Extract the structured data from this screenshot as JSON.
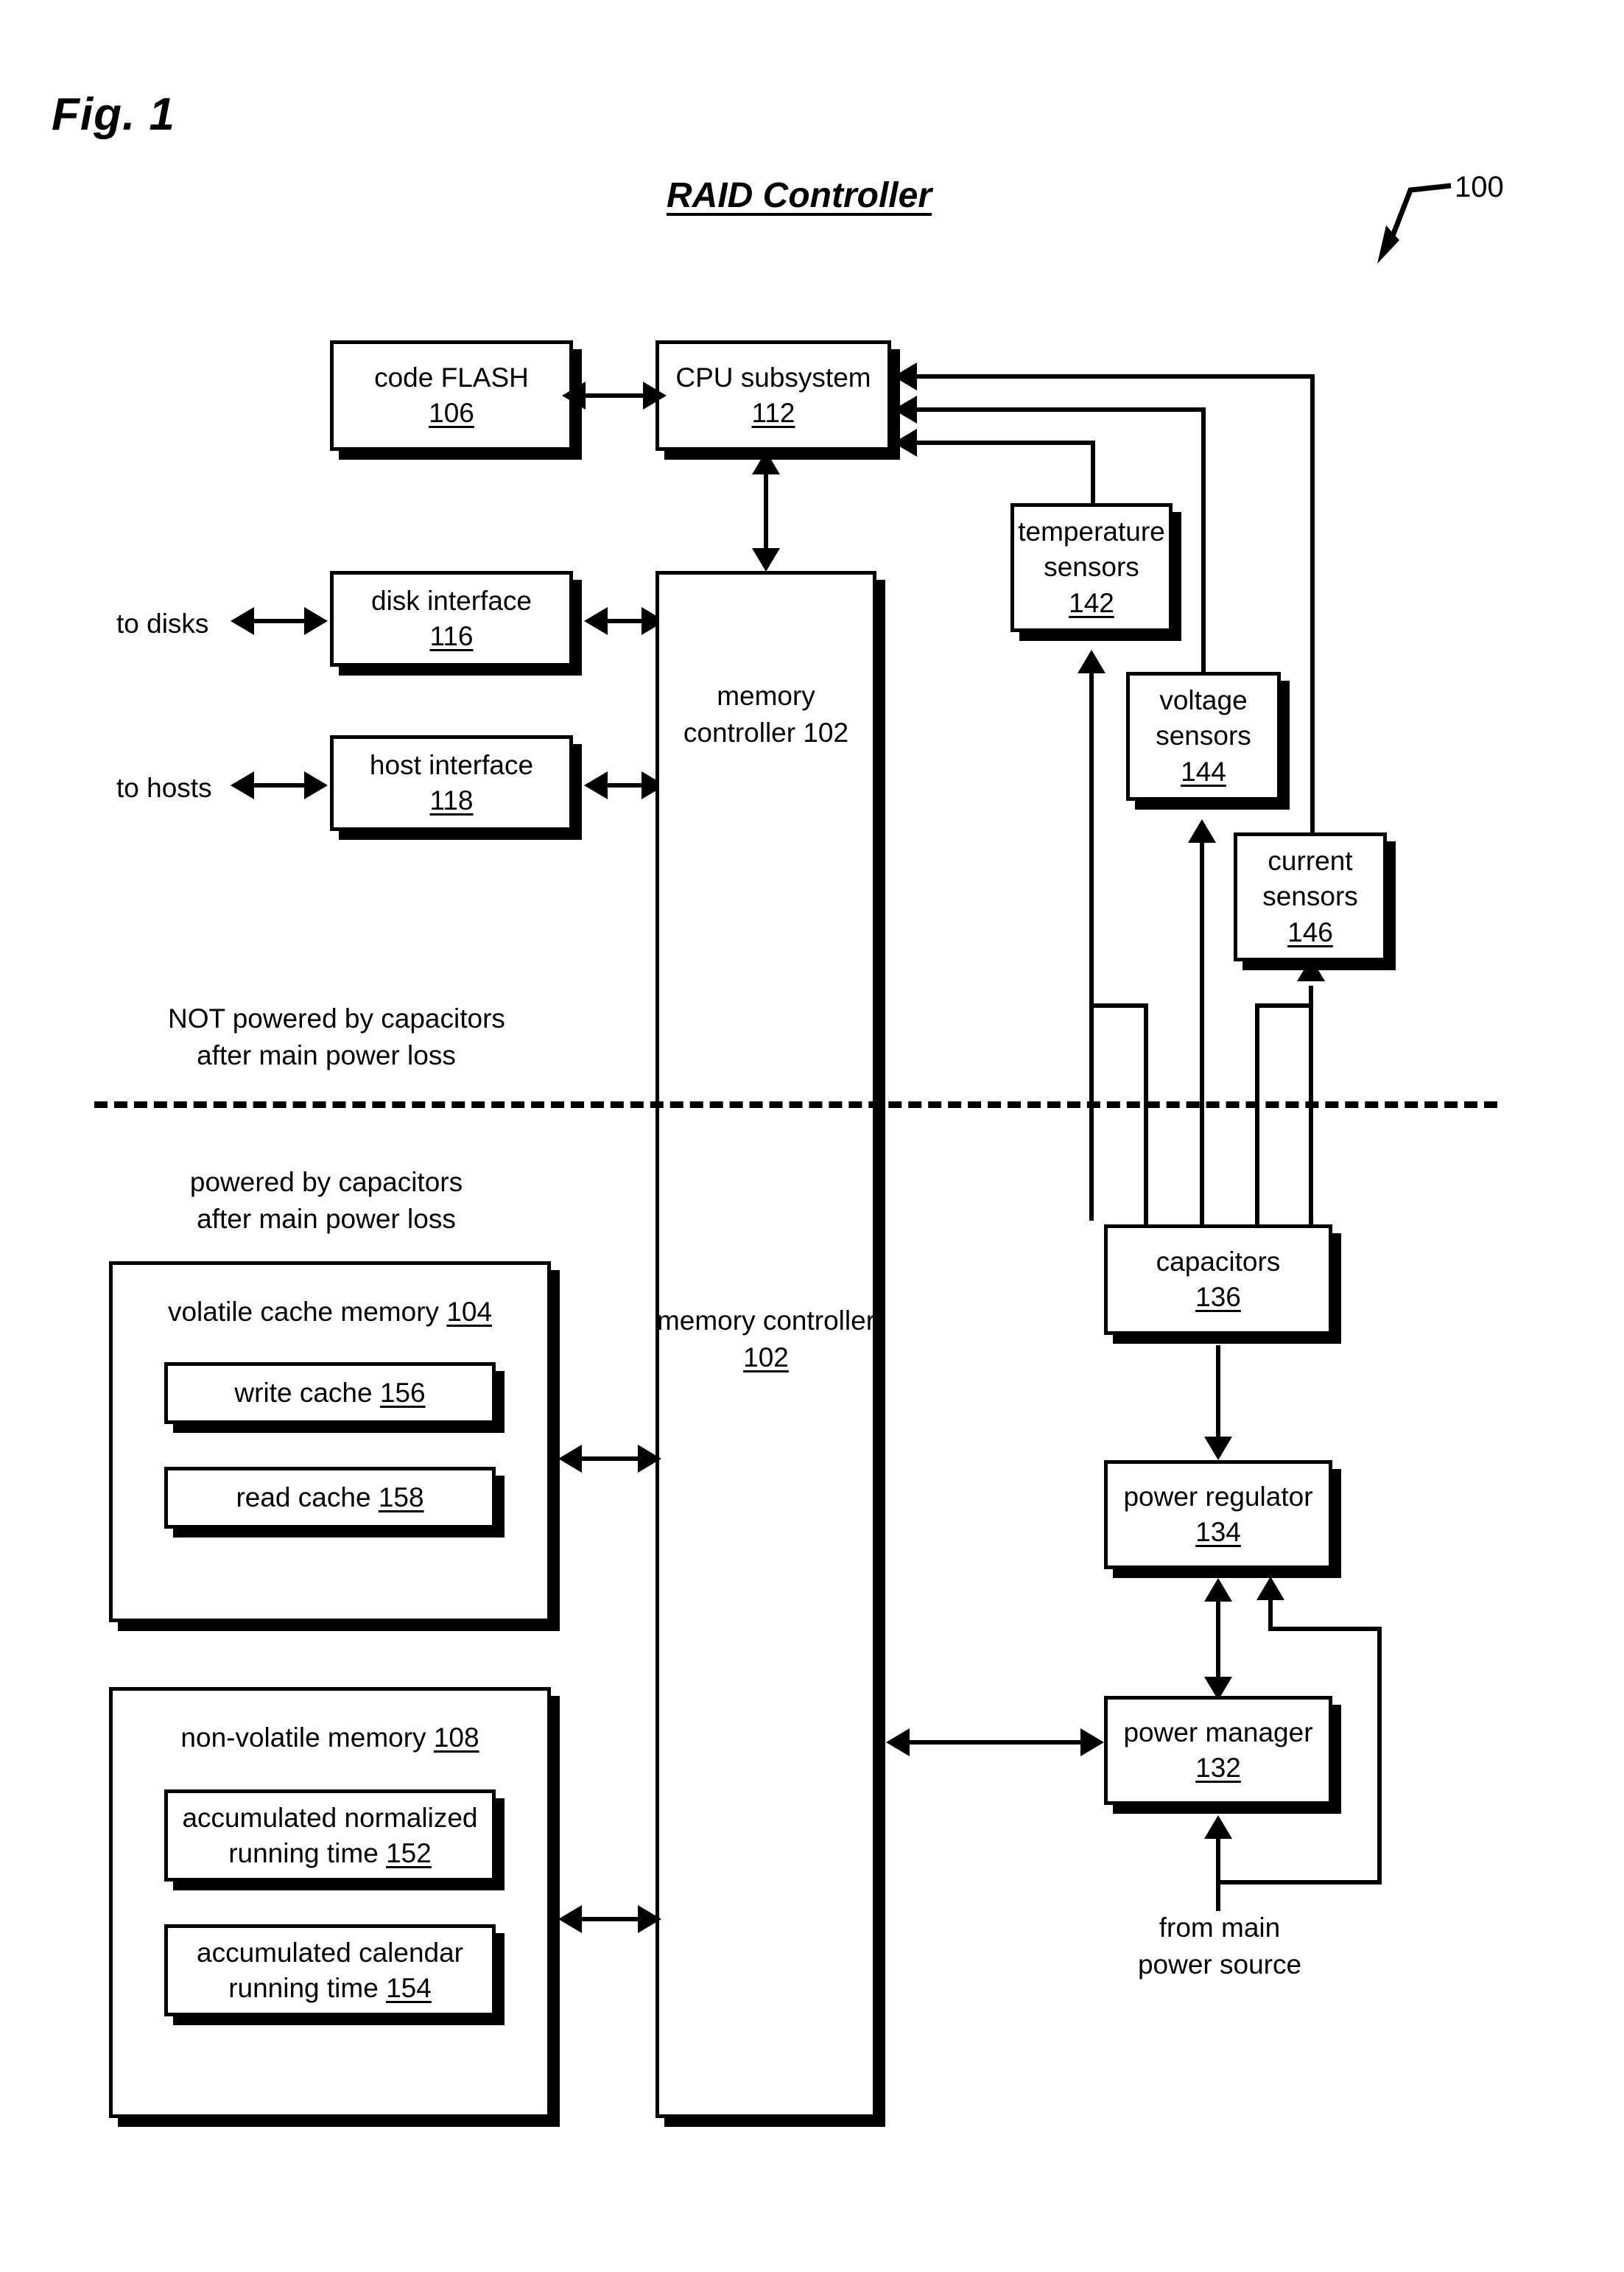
{
  "figure": {
    "label": "Fig. 1",
    "title": "RAID Controller",
    "reference_numeral": "100"
  },
  "blocks": [
    {
      "id": "code_flash",
      "title": "code FLASH",
      "number": "106"
    },
    {
      "id": "cpu_subsystem",
      "title": "CPU subsystem",
      "number": "112"
    },
    {
      "id": "disk_interface",
      "title": "disk interface",
      "number": "116"
    },
    {
      "id": "host_interface",
      "title": "host interface",
      "number": "118"
    },
    {
      "id": "memory_controller",
      "title": "memory controller",
      "number": "102"
    },
    {
      "id": "temperature_sensors",
      "title_line1": "temperature",
      "title_line2": "sensors",
      "number": "142"
    },
    {
      "id": "voltage_sensors",
      "title_line1": "voltage",
      "title_line2": "sensors",
      "number": "144"
    },
    {
      "id": "current_sensors",
      "title_line1": "current",
      "title_line2": "sensors",
      "number": "146"
    },
    {
      "id": "capacitors",
      "title": "capacitors",
      "number": "136"
    },
    {
      "id": "power_regulator",
      "title": "power regulator",
      "number": "134"
    },
    {
      "id": "power_manager",
      "title": "power manager",
      "number": "132"
    },
    {
      "id": "volatile_cache",
      "title": "volatile cache memory",
      "number": "104"
    },
    {
      "id": "write_cache",
      "title": "write cache",
      "number": "156"
    },
    {
      "id": "read_cache",
      "title": "read cache",
      "number": "158"
    },
    {
      "id": "non_volatile",
      "title": "non-volatile memory",
      "number": "108"
    },
    {
      "id": "acc_norm_time",
      "title_line1": "accumulated normalized",
      "title_line2": "running time",
      "number": "152"
    },
    {
      "id": "acc_cal_time",
      "title_line1": "accumulated calendar",
      "title_line2": "running time",
      "number": "154"
    }
  ],
  "labels": {
    "to_disks": "to disks",
    "to_hosts": "to hosts",
    "not_powered_line1": "NOT powered by capacitors",
    "not_powered_line2": "after main power loss",
    "powered_line1": "powered by capacitors",
    "powered_line2": "after main power loss",
    "from_main_line1": "from main",
    "from_main_line2": "power source"
  },
  "colors": {
    "ink": "#000000",
    "paper": "#ffffff"
  }
}
